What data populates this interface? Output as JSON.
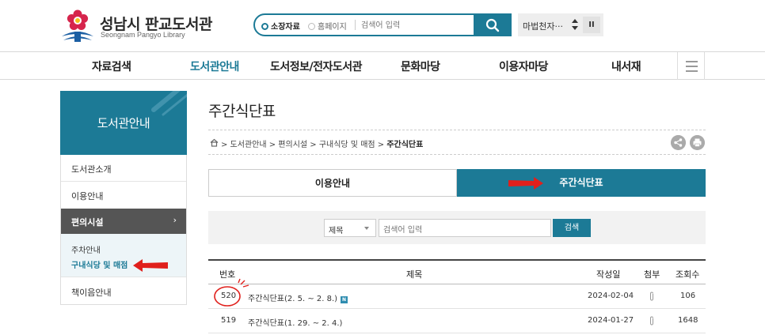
{
  "header": {
    "logo_title": "성남시 판교도서관",
    "logo_subtitle": "Seongnam Pangyo Library",
    "search": {
      "option_1": "소장자료",
      "option_2": "홈페이지",
      "placeholder": "검색어 입력"
    },
    "lang_select": "마법천자···",
    "pause_label": "II"
  },
  "gnb": {
    "items": [
      "자료검색",
      "도서관안내",
      "도서정보/전자도서관",
      "문화마당",
      "이용자마당",
      "내서재"
    ],
    "active_index": 1
  },
  "sidebar": {
    "title": "도서관안내",
    "items": [
      "도서관소개",
      "이용안내",
      "편의시설",
      "책이음안내"
    ],
    "active_label": "편의시설",
    "active_chevron": "›",
    "sub_items": [
      "주차안내",
      "구내식당 및 매점"
    ]
  },
  "main": {
    "page_title": "주간식단표",
    "breadcrumb": {
      "parts": "> 도서관안내 > 편의시설 > 구내식당 및 매점 > ",
      "current": "주간식단표"
    },
    "tabs": [
      "이용안내",
      "주간식단표"
    ],
    "filter": {
      "select_value": "제목",
      "input_placeholder": "검색어 입력",
      "button_label": "검색"
    },
    "table": {
      "headers": [
        "번호",
        "제목",
        "작성일",
        "첨부",
        "조회수"
      ],
      "rows": [
        {
          "no": "520",
          "title": "주간식단표(2. 5. ~ 2. 8.)",
          "new_badge": "N",
          "date": "2024-02-04",
          "views": "106"
        },
        {
          "no": "519",
          "title": "주간식단표(1. 29. ~ 2. 4.)",
          "new_badge": "",
          "date": "2024-01-27",
          "views": "1648"
        }
      ]
    }
  },
  "colors": {
    "accent": "#1c7a96",
    "sidebar_active": "#555555",
    "annotation_red": "#e0201c"
  }
}
